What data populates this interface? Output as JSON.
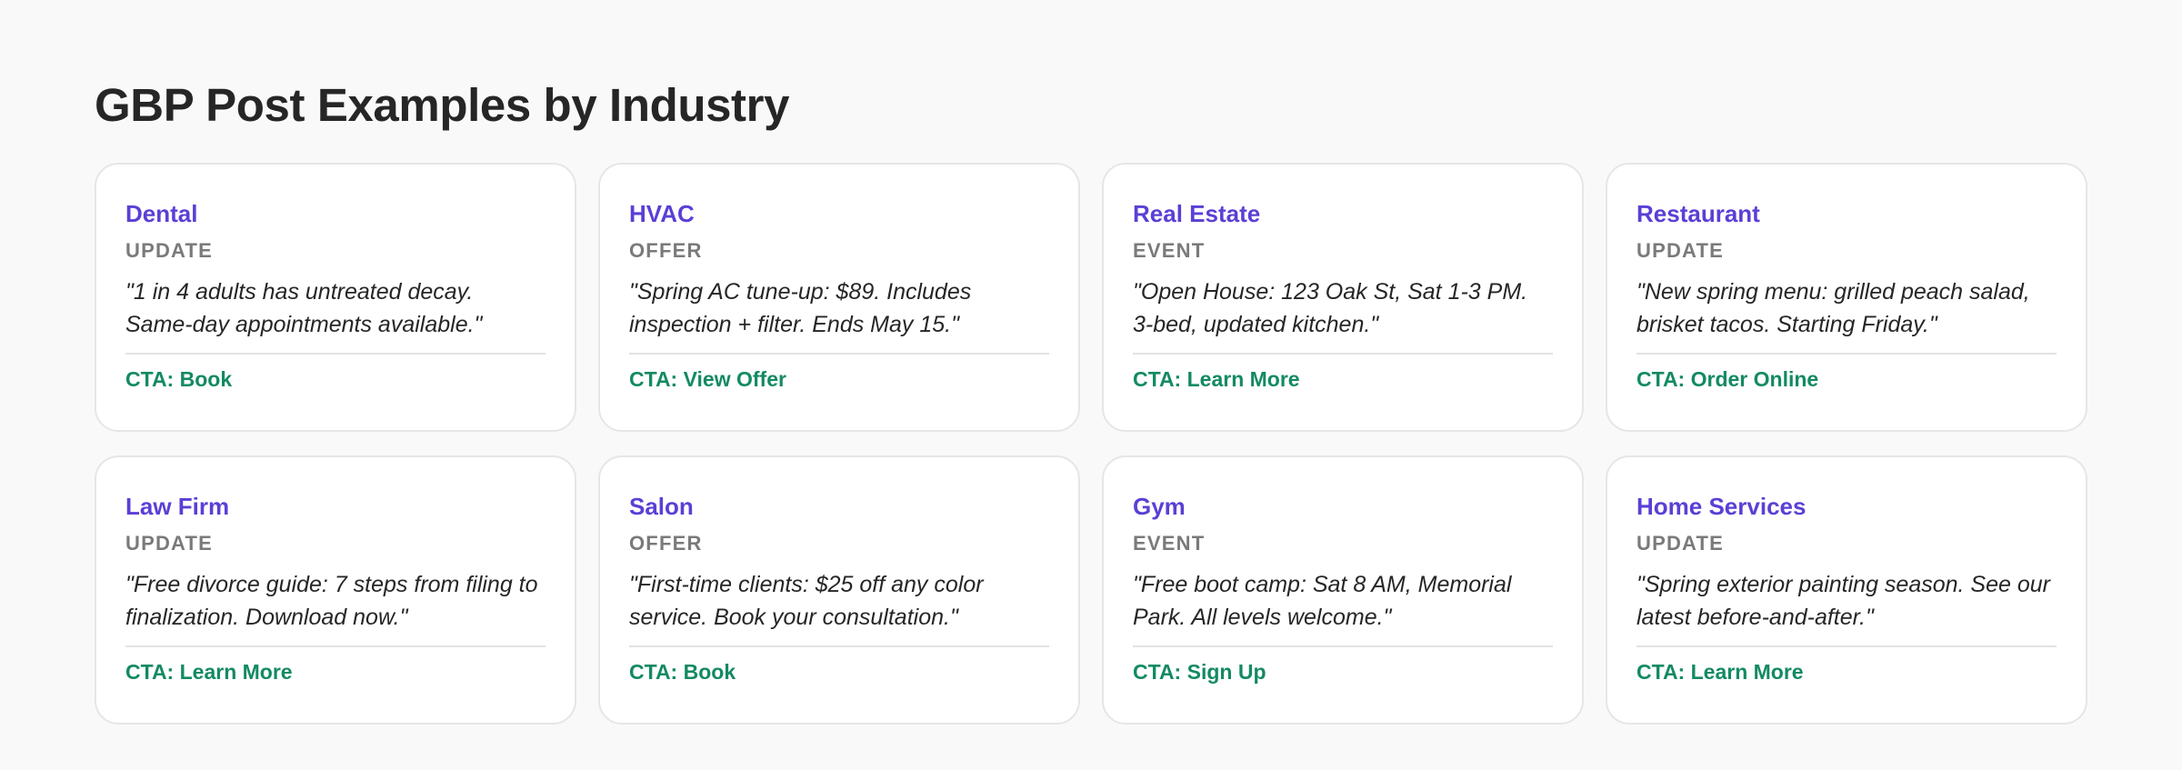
{
  "page": {
    "title": "GBP Post Examples by Industry"
  },
  "colors": {
    "industry": "#5b3fd6",
    "post_type": "#7a7a7a",
    "cta": "#138a63",
    "card_border": "#e6e6e6",
    "background": "#f9f9f9"
  },
  "cards": [
    {
      "industry": "Dental",
      "type": "UPDATE",
      "quote": "\"1 in 4 adults has untreated decay. Same-day appointments available.\"",
      "cta": "CTA: Book"
    },
    {
      "industry": "HVAC",
      "type": "OFFER",
      "quote": "\"Spring AC tune-up: $89. Includes inspection + filter. Ends May 15.\"",
      "cta": "CTA: View Offer"
    },
    {
      "industry": "Real Estate",
      "type": "EVENT",
      "quote": "\"Open House: 123 Oak St, Sat 1-3 PM. 3-bed, updated kitchen.\"",
      "cta": "CTA: Learn More"
    },
    {
      "industry": "Restaurant",
      "type": "UPDATE",
      "quote": "\"New spring menu: grilled peach salad, brisket tacos. Starting Friday.\"",
      "cta": "CTA: Order Online"
    },
    {
      "industry": "Law Firm",
      "type": "UPDATE",
      "quote": "\"Free divorce guide: 7 steps from filing to finalization. Download now.\"",
      "cta": "CTA: Learn More"
    },
    {
      "industry": "Salon",
      "type": "OFFER",
      "quote": "\"First-time clients: $25 off any color service. Book your consultation.\"",
      "cta": "CTA: Book"
    },
    {
      "industry": "Gym",
      "type": "EVENT",
      "quote": "\"Free boot camp: Sat 8 AM, Memorial Park. All levels welcome.\"",
      "cta": "CTA: Sign Up"
    },
    {
      "industry": "Home Services",
      "type": "UPDATE",
      "quote": "\"Spring exterior painting season. See our latest before-and-after.\"",
      "cta": "CTA: Learn More"
    }
  ]
}
